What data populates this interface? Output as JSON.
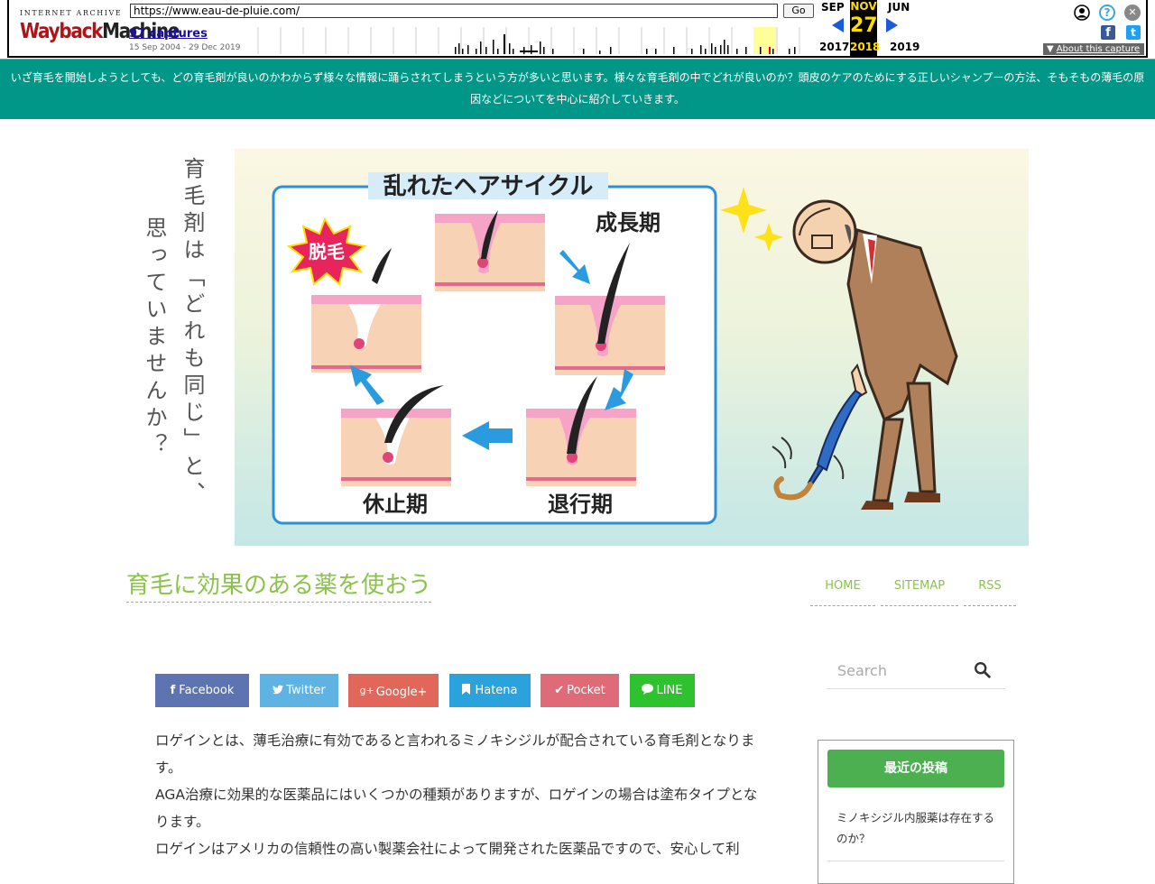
{
  "wayback": {
    "logo_top": "INTERNET ARCHIVE",
    "logo_main_a": "Wayback",
    "logo_main_b": "Machine",
    "url": "https://www.eau-de-pluie.com/",
    "go_label": "Go",
    "captures": "97 captures",
    "range": "15 Sep 2004 - 29 Dec 2019",
    "prev_month": "SEP",
    "cur_month": "NOV",
    "next_month": "JUN",
    "day": "27",
    "prev_year": "2017",
    "cur_year": "2018",
    "next_year": "2019",
    "about": "About this capture",
    "help_glyph": "?",
    "close_glyph": "✕",
    "fb_glyph": "f",
    "tw_glyph": "t"
  },
  "banner": {
    "text": "いざ育毛を開始しようとしても、どの育毛剤が良いのかわからず様々な情報に踊らされてしまうという方が多いと思います。様々な育毛剤の中でどれが良いのか？頭皮のケアのためにする正しいシャンプーの方法、そもそもの薄毛の原因などについてを中心に紹介していきます。"
  },
  "hero": {
    "vertical_col1": "育毛剤は「どれも同じ」と、",
    "vertical_col2": "思っていませんか？",
    "cycle_title": "乱れたヘアサイクル",
    "stage_growth": "成長期",
    "stage_regress": "退行期",
    "stage_rest": "休止期",
    "stage_shed": "脱毛"
  },
  "site": {
    "title": "育毛に効果のある薬を使おう"
  },
  "nav": {
    "home": "HOME",
    "sitemap": "SITEMAP",
    "rss": "RSS"
  },
  "share": {
    "facebook": "Facebook",
    "twitter": "Twitter",
    "google": "Google+",
    "hatena": "Hatena",
    "pocket": "Pocket",
    "line": "LINE",
    "facebook_glyph": "f",
    "google_glyph": "g+",
    "pocket_glyph": "✔",
    "colors": {
      "facebook": "#5d74b0",
      "twitter": "#5fb3e2",
      "google": "#e0675a",
      "hatena": "#2aa3dc",
      "pocket": "#e06b78",
      "line": "#2fc22f"
    }
  },
  "article": {
    "p1": "ロゲインとは、薄毛治療に有効であると言われるミノキシジルが配合されている育毛剤となります。",
    "p2": "AGA治療に効果的な医薬品にはいくつかの種類がありますが、ロゲインの場合は塗布タイプとなります。",
    "p3": "ロゲインはアメリカの信頼性の高い製薬会社によって開発された医薬品ですので、安心して利"
  },
  "sidebar": {
    "search_placeholder": "Search",
    "recent_title": "最近の投稿",
    "recent_item": "ミノキシジル内服薬は存在するのか？"
  },
  "icons": {
    "search": "search-icon",
    "user": "user-icon",
    "help": "help-icon",
    "close": "close-icon"
  }
}
